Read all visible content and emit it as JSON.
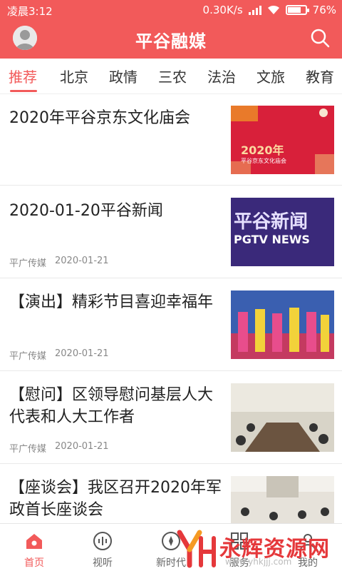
{
  "status_bar": {
    "time": "凌晨3:12",
    "network_speed": "0.30K/s",
    "battery": "76%",
    "battery_level": 0.76
  },
  "header": {
    "title": "平谷融媒",
    "avatar_icon": "user-avatar-icon",
    "search_icon": "search-icon"
  },
  "tabs": [
    {
      "label": "推荐",
      "active": true
    },
    {
      "label": "北京",
      "active": false
    },
    {
      "label": "政情",
      "active": false
    },
    {
      "label": "三农",
      "active": false
    },
    {
      "label": "法治",
      "active": false
    },
    {
      "label": "文旅",
      "active": false
    },
    {
      "label": "教育",
      "active": false
    }
  ],
  "feed": [
    {
      "title": "2020年平谷京东文化庙会",
      "source": "",
      "date": "",
      "thumb_title": "2020年",
      "thumb_subtitle": "平谷京东文化庙会"
    },
    {
      "title": "2020-01-20平谷新闻",
      "source": "平广传媒",
      "date": "2020-01-21",
      "thumb_title": "平谷新闻",
      "thumb_subtitle": "PGTV NEWS"
    },
    {
      "title": "【演出】精彩节目喜迎幸福年",
      "source": "平广传媒",
      "date": "2020-01-21"
    },
    {
      "title": "【慰问】区领导慰问基层人大代表和人大工作者",
      "source": "平广传媒",
      "date": "2020-01-21"
    },
    {
      "title": "【座谈会】我区召开2020年军政首长座谈会",
      "source": "",
      "date": ""
    }
  ],
  "bottom_nav": [
    {
      "label": "首页",
      "icon": "home-icon",
      "active": true
    },
    {
      "label": "视听",
      "icon": "audio-icon",
      "active": false
    },
    {
      "label": "新时代",
      "icon": "compass-icon",
      "active": false
    },
    {
      "label": "服务",
      "icon": "grid-icon",
      "active": false
    },
    {
      "label": "我的",
      "icon": "user-icon",
      "active": false
    }
  ],
  "watermark": {
    "text": "永辉资源网",
    "url": "www.yhkjjj.com"
  },
  "colors": {
    "brand": "#f25a5a",
    "text": "#222222",
    "meta": "#888888"
  }
}
